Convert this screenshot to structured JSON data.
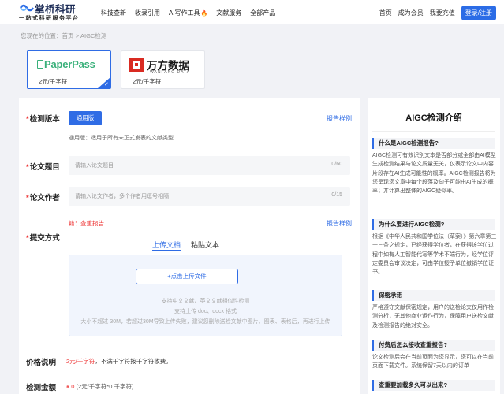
{
  "header": {
    "logo_name": "掌桥科研",
    "logo_sub": "一站式科研服务平台",
    "nav": [
      "科技查新",
      "收录引用",
      "AI写作工具",
      "文献服务",
      "全部产品"
    ],
    "right": [
      "首页",
      "成为会员",
      "我要充值"
    ],
    "login": "登录/注册"
  },
  "breadcrumb": "您现在的位置：首页 > AIGC检测",
  "products": [
    {
      "logo": "PaperPass",
      "price": "2元/千字符",
      "selected": true
    },
    {
      "logo": "万方数据",
      "logo_sub": "WANFANG DATA",
      "price": "2元/千字符",
      "selected": false
    }
  ],
  "form": {
    "version_label": "检测版本",
    "version_button": "通用版",
    "version_desc": "通用版：适用于所有未正式发表的文献类型",
    "sample_link": "报告样例",
    "title_label": "论文题目",
    "title_placeholder": "请输入论文题目",
    "title_count": "0/60",
    "author_label": "论文作者",
    "author_placeholder": "请输入论文作者，多个作者用逗号相隔",
    "author_count": "0/15",
    "warn_prefix": "籍：",
    "warn_link": "查重报告",
    "sample_link2": "报告样例",
    "submit_label": "提交方式",
    "tabs": [
      "上传文档",
      "粘贴文本"
    ],
    "upload_button": "+点击上传文件",
    "hint1": "支持中文文献、英文文献相似性检测",
    "hint2": "支持上传 doc、docx 格式",
    "hint3": "大小不超过 30M，若超过30M导致上传失败，建议您删除送检文献中图片、图表、表格后，再进行上传",
    "price_label": "价格说明",
    "price_red": "2元/千字符",
    "price_rest": "，不满千字符按千字符收费。",
    "amount_label": "检测金额",
    "amount_red": "¥ 0",
    "amount_rest": " (2元/千字符*0 千字符)"
  },
  "sidebar": {
    "title": "AIGC检测介绍",
    "sections": [
      {
        "q": "什么是AIGC检测报告?",
        "a": "AIGC检测可有效识别文本是否部分或全部由AI模型生成检测结果与论文质量无关，仅表示论文中内容片段存在AI生成可能性的概率。AIGC检测报告将为您呈现您文章中每个段落及句子可能由AI生成的概率；并计算出整体的AIGC疑似率。"
      },
      {
        "q": "为什么要进行AIGC检测?",
        "a": "根据《中华人民共和国学位法（草案）》第六章第三十三条之规定，已经获得学位者，在获得该学位过程中如有人工智能代写等学术不端行为，经学位评定委员会审议决定，可由学位授予单位撤销学位证书。"
      },
      {
        "q": "保密承诺",
        "a": "严格遵守文献保密规定，用户的送检论文仅用作检测分析，无其他商业运作行为，保障用户送检文献及检测报告的绝对安全。"
      },
      {
        "q": "付费后怎么接收查重报告?",
        "a": "论文检测后会在当前页面为您显示，您可以在当前页面下载文件。系统保留7天以内的订单"
      },
      {
        "q": "查重要加载多久可以出来?",
        "a": ""
      }
    ]
  },
  "colors": {
    "accent": "#2f6ce5",
    "warn": "#e33333",
    "paperpass": "#39b07a",
    "wanfang": "#d92b22"
  }
}
